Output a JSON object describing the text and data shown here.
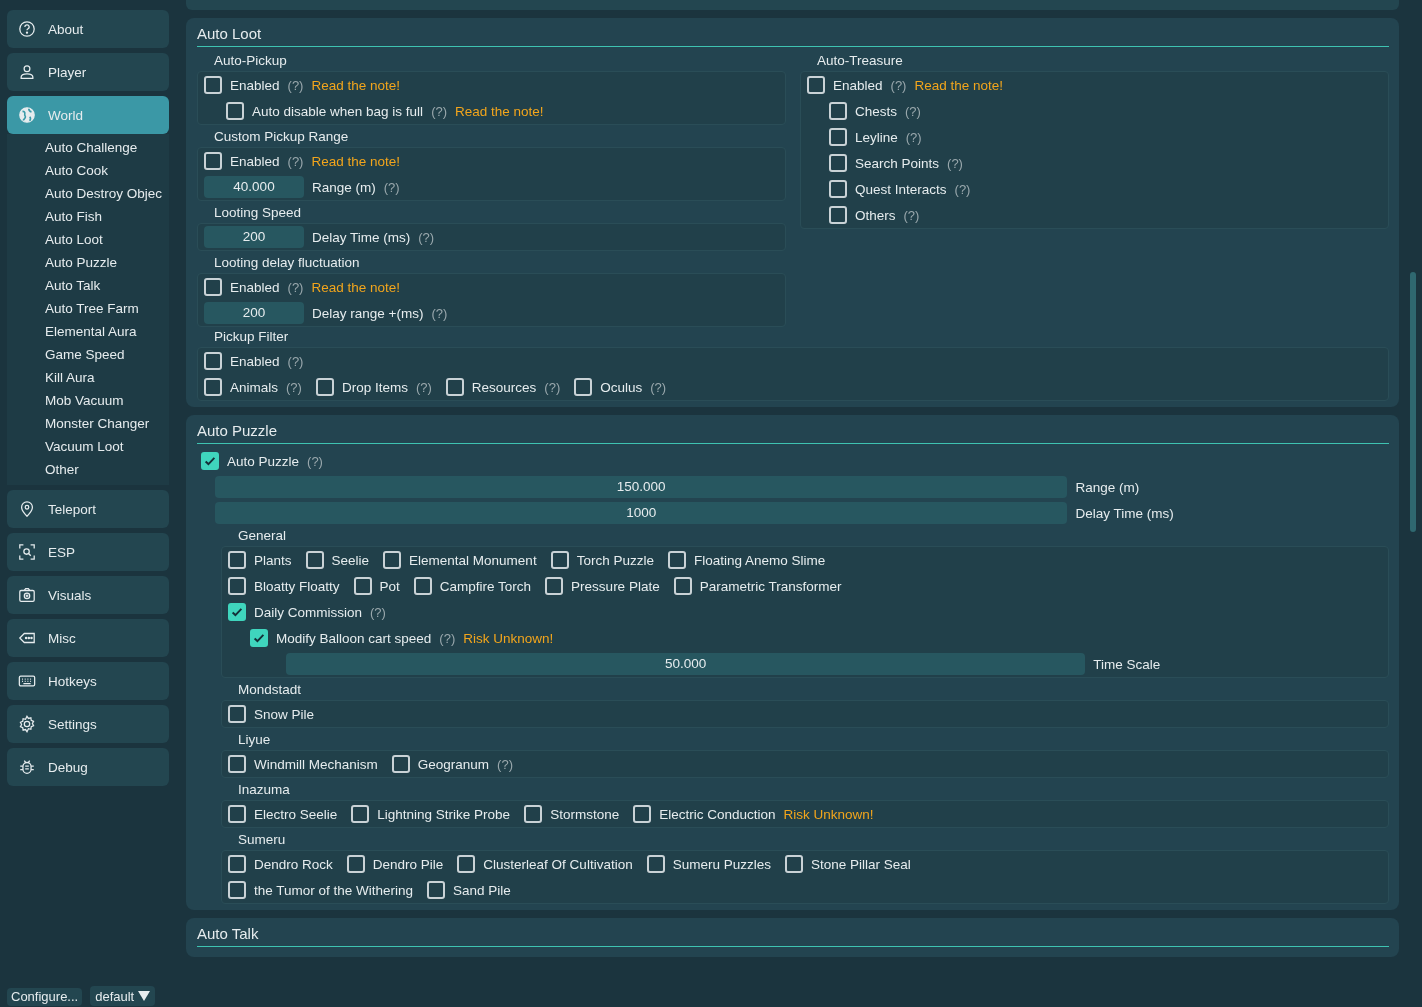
{
  "sidebar": {
    "items": [
      {
        "label": "About",
        "selected": false
      },
      {
        "label": "Player",
        "selected": false
      },
      {
        "label": "World",
        "selected": true,
        "children": [
          {
            "label": "Auto Challenge",
            "selected": false
          },
          {
            "label": "Auto Cook",
            "selected": false
          },
          {
            "label": "Auto Destroy Objec",
            "selected": false
          },
          {
            "label": "Auto Fish",
            "selected": false
          },
          {
            "label": "Auto Loot",
            "selected": false
          },
          {
            "label": "Auto Puzzle",
            "selected": false
          },
          {
            "label": "Auto Talk",
            "selected": false
          },
          {
            "label": "Auto Tree Farm",
            "selected": false
          },
          {
            "label": "Elemental Aura",
            "selected": false
          },
          {
            "label": "Game Speed",
            "selected": false
          },
          {
            "label": "Kill Aura",
            "selected": false
          },
          {
            "label": "Mob Vacuum",
            "selected": false
          },
          {
            "label": "Monster Changer",
            "selected": false
          },
          {
            "label": "Vacuum Loot",
            "selected": false
          },
          {
            "label": "Other",
            "selected": false
          }
        ]
      },
      {
        "label": "Teleport",
        "selected": false
      },
      {
        "label": "ESP",
        "selected": false
      },
      {
        "label": "Visuals",
        "selected": false
      },
      {
        "label": "Misc",
        "selected": false
      },
      {
        "label": "Hotkeys",
        "selected": false
      },
      {
        "label": "Settings",
        "selected": false
      },
      {
        "label": "Debug",
        "selected": false
      }
    ]
  },
  "config_bar": {
    "configure": "Configure...",
    "profile": "default"
  },
  "sections": [
    {
      "title": "Auto Loot",
      "columns": [
        [
          {
            "title": "Auto-Pickup",
            "rows": [
              {
                "items": [
                  {
                    "kind": "checkbox",
                    "label": "Enabled",
                    "checked": false,
                    "help": "(?)",
                    "note": "Read the note!"
                  }
                ],
                "children": [
                  {
                    "items": [
                      {
                        "kind": "checkbox",
                        "label": "Auto disable when bag is full",
                        "checked": false,
                        "help": "(?)",
                        "note": "Read the note!"
                      }
                    ]
                  }
                ]
              }
            ]
          },
          {
            "title": "Custom Pickup Range",
            "rows": [
              {
                "items": [
                  {
                    "kind": "checkbox",
                    "label": "Enabled",
                    "checked": false,
                    "help": "(?)",
                    "note": "Read the note!"
                  }
                ]
              },
              {
                "items": [
                  {
                    "kind": "field",
                    "value": "40.000",
                    "label": "Range (m)",
                    "help": "(?)"
                  }
                ]
              }
            ]
          },
          {
            "title": "Looting Speed",
            "rows": [
              {
                "items": [
                  {
                    "kind": "field",
                    "value": "200",
                    "label": "Delay Time (ms)",
                    "help": "(?)"
                  }
                ]
              }
            ]
          },
          {
            "title": "Looting delay fluctuation",
            "rows": [
              {
                "items": [
                  {
                    "kind": "checkbox",
                    "label": "Enabled",
                    "checked": false,
                    "help": "(?)",
                    "note": "Read the note!"
                  }
                ]
              },
              {
                "items": [
                  {
                    "kind": "field",
                    "value": "200",
                    "label": "Delay range +(ms)",
                    "help": "(?)"
                  }
                ]
              }
            ]
          }
        ],
        [
          {
            "title": "Auto-Treasure",
            "rows": [
              {
                "items": [
                  {
                    "kind": "checkbox",
                    "label": "Enabled",
                    "checked": false,
                    "help": "(?)",
                    "note": "Read the note!"
                  }
                ],
                "children": [
                  {
                    "items": [
                      {
                        "kind": "checkbox",
                        "label": "Chests",
                        "checked": false,
                        "help": "(?)"
                      }
                    ]
                  },
                  {
                    "items": [
                      {
                        "kind": "checkbox",
                        "label": "Leyline",
                        "checked": false,
                        "help": "(?)"
                      }
                    ]
                  },
                  {
                    "items": [
                      {
                        "kind": "checkbox",
                        "label": "Search Points",
                        "checked": false,
                        "help": "(?)"
                      }
                    ]
                  },
                  {
                    "items": [
                      {
                        "kind": "checkbox",
                        "label": "Quest Interacts",
                        "checked": false,
                        "help": "(?)"
                      }
                    ]
                  },
                  {
                    "items": [
                      {
                        "kind": "checkbox",
                        "label": "Others",
                        "checked": false,
                        "help": "(?)"
                      }
                    ]
                  }
                ]
              }
            ]
          }
        ]
      ],
      "groups": [
        {
          "title": "Pickup Filter",
          "rows": [
            {
              "items": [
                {
                  "kind": "checkbox",
                  "label": "Enabled",
                  "checked": false,
                  "help": "(?)"
                }
              ]
            },
            {
              "items": [
                {
                  "kind": "checkbox",
                  "label": "Animals",
                  "checked": false,
                  "help": "(?)"
                },
                {
                  "kind": "checkbox",
                  "label": "Drop Items",
                  "checked": false,
                  "help": "(?)"
                },
                {
                  "kind": "checkbox",
                  "label": "Resources",
                  "checked": false,
                  "help": "(?)"
                },
                {
                  "kind": "checkbox",
                  "label": "Oculus",
                  "checked": false,
                  "help": "(?)"
                }
              ]
            }
          ]
        }
      ]
    },
    {
      "title": "Auto Puzzle",
      "rows": [
        {
          "items": [
            {
              "kind": "checkbox",
              "label": "Auto Puzzle",
              "checked": true,
              "help": "(?)"
            }
          ]
        },
        {
          "items": [
            {
              "kind": "bar_field",
              "value": "150.000",
              "label": "Range (m)"
            }
          ]
        },
        {
          "items": [
            {
              "kind": "bar_field",
              "value": "1000",
              "label": "Delay Time (ms)"
            }
          ]
        }
      ],
      "groups": [
        {
          "title": "General",
          "rows": [
            {
              "items": [
                {
                  "kind": "checkbox",
                  "label": "Plants",
                  "checked": false
                },
                {
                  "kind": "checkbox",
                  "label": "Seelie",
                  "checked": false
                },
                {
                  "kind": "checkbox",
                  "label": "Elemental Monument",
                  "checked": false
                },
                {
                  "kind": "checkbox",
                  "label": "Torch Puzzle",
                  "checked": false
                },
                {
                  "kind": "checkbox",
                  "label": "Floating Anemo Slime",
                  "checked": false
                }
              ]
            },
            {
              "items": [
                {
                  "kind": "checkbox",
                  "label": "Bloatty Floatty",
                  "checked": false
                },
                {
                  "kind": "checkbox",
                  "label": "Pot",
                  "checked": false
                },
                {
                  "kind": "checkbox",
                  "label": "Campfire Torch",
                  "checked": false
                },
                {
                  "kind": "checkbox",
                  "label": "Pressure Plate",
                  "checked": false
                },
                {
                  "kind": "checkbox",
                  "label": "Parametric Transformer",
                  "checked": false
                }
              ]
            },
            {
              "items": [
                {
                  "kind": "checkbox",
                  "label": "Daily Commission",
                  "checked": true,
                  "help": "(?)"
                }
              ],
              "children": [
                {
                  "items": [
                    {
                      "kind": "checkbox",
                      "label": "Modify Balloon cart speed",
                      "checked": true,
                      "help": "(?)",
                      "note": "Risk Unknown!"
                    }
                  ],
                  "children": [
                    {
                      "items": [
                        {
                          "kind": "bar_field",
                          "value": "50.000",
                          "label": "Time Scale"
                        }
                      ]
                    }
                  ]
                }
              ]
            }
          ]
        },
        {
          "title": "Mondstadt",
          "rows": [
            {
              "items": [
                {
                  "kind": "checkbox",
                  "label": "Snow Pile",
                  "checked": false
                }
              ]
            }
          ]
        },
        {
          "title": "Liyue",
          "rows": [
            {
              "items": [
                {
                  "kind": "checkbox",
                  "label": "Windmill Mechanism",
                  "checked": false
                },
                {
                  "kind": "checkbox",
                  "label": "Geogranum",
                  "checked": false,
                  "help": "(?)"
                }
              ]
            }
          ]
        },
        {
          "title": "Inazuma",
          "rows": [
            {
              "items": [
                {
                  "kind": "checkbox",
                  "label": "Electro Seelie",
                  "checked": false
                },
                {
                  "kind": "checkbox",
                  "label": "Lightning Strike Probe",
                  "checked": false
                },
                {
                  "kind": "checkbox",
                  "label": "Stormstone",
                  "checked": false
                },
                {
                  "kind": "checkbox",
                  "label": "Electric Conduction",
                  "checked": false,
                  "note": "Risk Unknown!"
                }
              ]
            }
          ]
        },
        {
          "title": "Sumeru",
          "rows": [
            {
              "items": [
                {
                  "kind": "checkbox",
                  "label": "Dendro Rock",
                  "checked": false
                },
                {
                  "kind": "checkbox",
                  "label": "Dendro Pile",
                  "checked": false
                },
                {
                  "kind": "checkbox",
                  "label": "Clusterleaf Of Cultivation",
                  "checked": false
                },
                {
                  "kind": "checkbox",
                  "label": "Sumeru Puzzles",
                  "checked": false
                },
                {
                  "kind": "checkbox",
                  "label": "Stone Pillar Seal",
                  "checked": false
                }
              ]
            },
            {
              "items": [
                {
                  "kind": "checkbox",
                  "label": "the Tumor of the Withering",
                  "checked": false
                },
                {
                  "kind": "checkbox",
                  "label": "Sand Pile",
                  "checked": false
                }
              ]
            }
          ]
        }
      ]
    },
    {
      "title": "Auto Talk"
    }
  ]
}
